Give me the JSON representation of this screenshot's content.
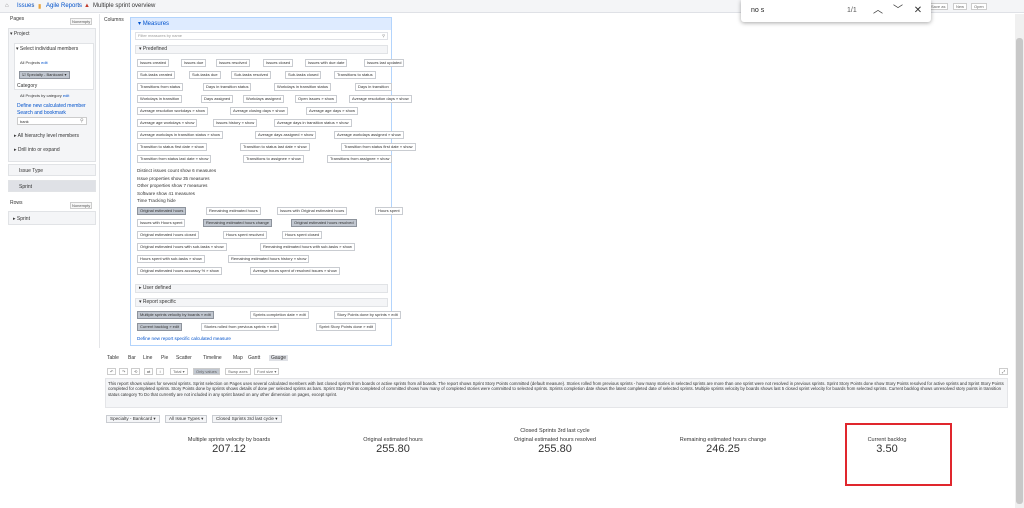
{
  "breadcrumb": {
    "issues": "Issues",
    "agile": "Agile Reports",
    "current": "Multiple sprint overview"
  },
  "toolbar": {
    "save_as": "Save as",
    "new": "New",
    "open": "Open"
  },
  "find": {
    "query": "no s",
    "count": "1/1"
  },
  "pages": {
    "label": "Pages",
    "nonempty": "Nonempty",
    "project": "Project",
    "select_members": "Select individual members",
    "all_projects": "All Projects",
    "edit": "edit",
    "specialty": "Specialty - Bankcard",
    "category": "Category",
    "all_by_category": "All Projects by category",
    "define_member": "Define new calculated member",
    "search_bookmark": "Search and bookmark",
    "search_value": "bank",
    "hierarchy": "All hierarchy level members",
    "drill": "Drill into or expand",
    "issue_type": "Issue Type",
    "sprint": "Sprint"
  },
  "rows": {
    "label": "Rows",
    "nonempty": "Nonempty",
    "sprint": "Sprint"
  },
  "columns": {
    "label": "Columns"
  },
  "measures": {
    "title": "Measures",
    "filter_placeholder": "Filter measures by name",
    "predefined": "Predefined",
    "user_defined": "User defined",
    "report_specific": "Report specific",
    "define_report_measure": "Define new report specific calculated measure",
    "rows": [
      [
        "Issues created",
        "Issues due",
        "Issues resolved",
        "Issues closed",
        "Issues with due date",
        "Issues last updated"
      ],
      [
        "Sub-tasks created",
        "Sub-tasks due",
        "Sub-tasks resolved",
        "Sub-tasks closed",
        "Transitions to status"
      ],
      [
        "Transitions from status",
        "Days in transition status",
        "Workdays in transition status",
        "Days in transition"
      ],
      [
        "Workdays in transition",
        "Days assigned",
        "Workdays assigned",
        "Open issues » show",
        "Average resolution days » show"
      ],
      [
        "Average resolution workdays » show",
        "Average closing days » show",
        "Average age days » show"
      ],
      [
        "Average age workdays » show",
        "Issues history » show",
        "Average days in transition status » show"
      ],
      [
        "Average workdays in transition status » show",
        "Average days assigned » show",
        "Average workdays assigned » show"
      ],
      [
        "Transition to status first date » show",
        "Transition to status last date » show",
        "Transition from status first date » show"
      ],
      [
        "Transition from status last date » show",
        "Transitions to assignee » show",
        "Transitions from assignee » show"
      ]
    ],
    "lines": [
      "Distinct issues count show 6 measures",
      "Issue properties show 35 measures",
      "Other properties show 7 measures",
      "Software show 41 measures",
      "Time Tracking hide"
    ],
    "time_rows": [
      [
        "Original estimated hours",
        "Remaining estimated hours",
        "Issues with Original estimated hours",
        "Hours spent"
      ],
      [
        "Issues with Hours spent",
        "Remaining estimated hours change",
        "Original estimated hours resolved"
      ],
      [
        "Original estimated hours closed",
        "Hours spent resolved",
        "Hours spent closed"
      ],
      [
        "Original estimated hours with sub-tasks » show",
        "Remaining estimated hours with sub-tasks » show"
      ],
      [
        "Hours spent with sub-tasks » show",
        "Remaining estimated hours history » show"
      ],
      [
        "Original estimated hours accuracy % » show",
        "Average hours spent of resolved issues » show"
      ]
    ],
    "report_rows": [
      [
        "Multiple sprints velocity by boards » edit",
        "Sprints completion date » edit",
        "Story Points done by sprints » edit"
      ],
      [
        "Current backlog » edit",
        "Stories rolled from previous sprints » edit",
        "Sprint Story Points done » edit"
      ]
    ]
  },
  "view_tabs": [
    "Table",
    "Bar",
    "Line",
    "Pie",
    "Scatter",
    "Timeline",
    "Map",
    "Gantt",
    "Gauge"
  ],
  "tools": {
    "total": "Total",
    "only_values": "Only values",
    "swap_axes": "Swap axes",
    "font_size": "Font size"
  },
  "description": "This report shows values for several sprints. Sprint selection on Pages uses several calculated members with last closed sprints from boards or active sprints from all boards. The report shows Sprint Story Points committed (default measure). Stories rolled from previous sprints - how many stories in selected sprints are more than one sprint were not resolved in previous sprints. Sprint Story Points done show Story Points resolved for active sprints and Sprint Story Points completed for completed sprints. Story Points done by sprints shows details of done per selected sprints as bars. Sprint Story Points completed of committed shows how many of completed stories were committed to selected sprints. Sprints completion date shows the latest completed date of selected sprints. Multiple sprints velocity by boards shows last 5 closed sprint velocity for boards from selected sprints. Current backlog shows unresolved story points in transition status category To Do that currently are not included in any sprint based on any other dimension on pages, except sprint.",
  "filters": [
    "Specialty - Bankcard",
    "All Issue Types",
    "Closed Sprints 3rd last cycle"
  ],
  "gauge": {
    "group_title": "Closed Sprints 3rd last cycle",
    "items": [
      {
        "title": "Multiple sprints velocity by boards",
        "value": "207.12"
      },
      {
        "title": "Original estimated hours",
        "value": "255.80"
      },
      {
        "title": "Original estimated hours resolved",
        "value": "255.80"
      },
      {
        "title": "Remaining estimated hours change",
        "value": "246.25"
      },
      {
        "title": "Current backlog",
        "value": "3.50"
      }
    ]
  },
  "colors": {
    "accent": "#0052cc",
    "highlight": "#e0262d"
  }
}
